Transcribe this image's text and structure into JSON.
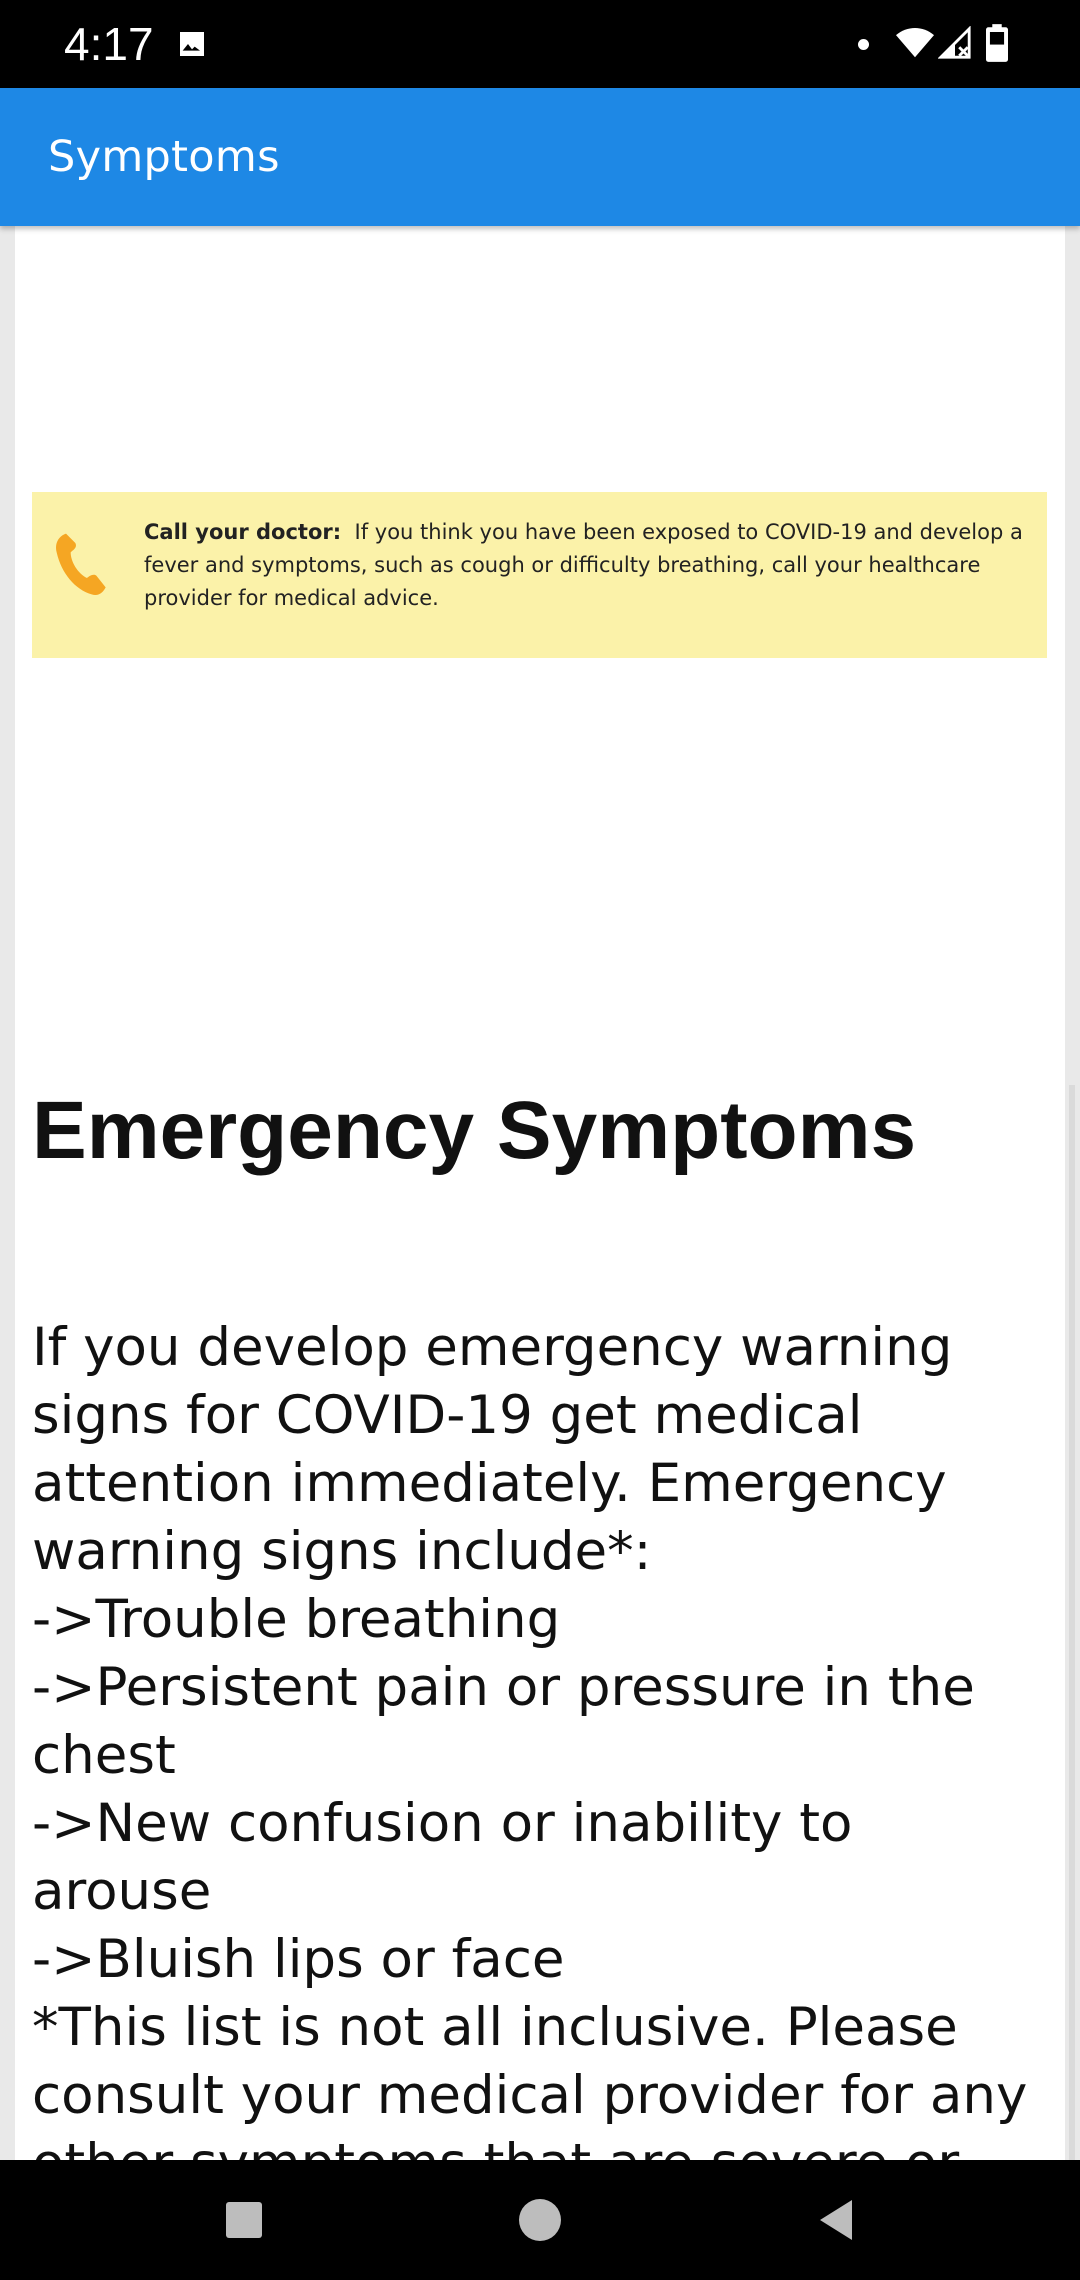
{
  "status_bar": {
    "time": "4:17",
    "icons": [
      "image-icon",
      "notification-dot-icon",
      "wifi-icon",
      "signal-icon",
      "battery-icon"
    ]
  },
  "app_bar": {
    "title": "Symptoms",
    "color": "#1e88e5"
  },
  "callout": {
    "background": "#fbf2a9",
    "icon": "phone-icon",
    "label": "Call your doctor:",
    "text": "If you think you have been exposed to COVID-19 and develop a fever and symptoms, such as cough or difficulty breathing, call your healthcare provider for medical advice."
  },
  "emergency": {
    "heading": "Emergency Symptoms",
    "body": "If you develop emergency warning signs for COVID-19 get medical attention immediately. Emergency warning signs include*:\n->Trouble breathing\n->Persistent pain or pressure in the chest\n->New confusion or inability to arouse\n->Bluish lips or face\n*This list is not all inclusive. Please consult your medical provider for any other symptoms that are severe or concerning."
  },
  "nav_bar": {
    "buttons": [
      "recents-button",
      "home-button",
      "back-button"
    ]
  }
}
